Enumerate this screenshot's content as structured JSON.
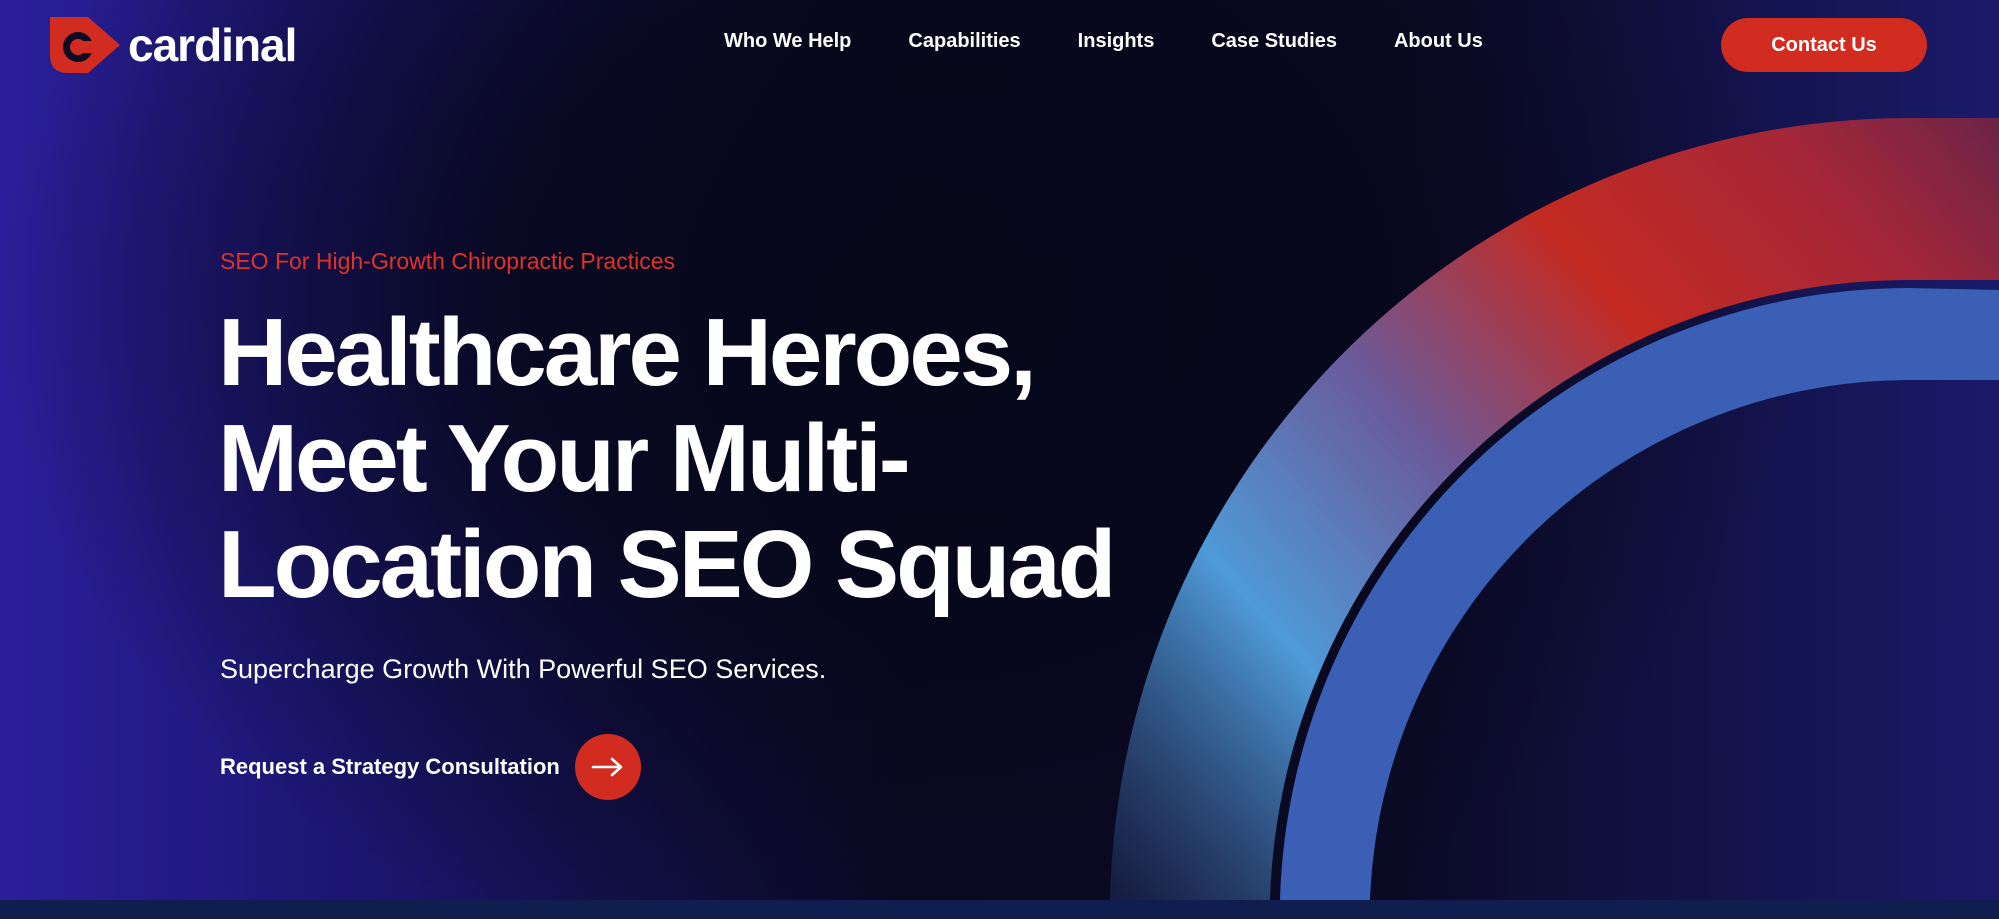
{
  "brand": {
    "name": "cardinal"
  },
  "nav": {
    "items": [
      {
        "label": "Who We Help"
      },
      {
        "label": "Capabilities"
      },
      {
        "label": "Insights"
      },
      {
        "label": "Case Studies"
      },
      {
        "label": "About Us"
      }
    ]
  },
  "header": {
    "contact_label": "Contact Us"
  },
  "hero": {
    "eyebrow": "SEO For High-Growth Chiropractic Practices",
    "headline_lines": [
      "Healthcare Heroes,",
      "Meet Your Multi-",
      "Location SEO Squad"
    ],
    "subhead": "Supercharge Growth With Powerful SEO Services.",
    "cta_label": "Request a Strategy Consultation",
    "cta_icon": "arrow-right-icon"
  },
  "colors": {
    "accent_red": "#d22c20",
    "background_dark": "#0b0a25",
    "background_blue": "#2a1f9a",
    "arc_blue": "#3a5fb4",
    "arc_light_blue": "#4f9ad8"
  }
}
